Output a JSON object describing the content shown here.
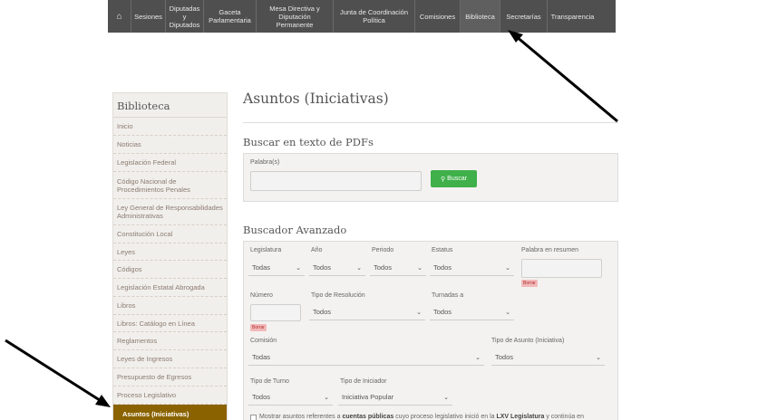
{
  "nav": {
    "items": [
      {
        "label": "Sesiones"
      },
      {
        "label": "Diputadas y Diputados"
      },
      {
        "label": "Gaceta Parlamentaria"
      },
      {
        "label": "Mesa Directiva y Diputación Permanente"
      },
      {
        "label": "Junta de Coordinación Política"
      },
      {
        "label": "Comisiones"
      },
      {
        "label": "Biblioteca"
      },
      {
        "label": "Secretarías"
      },
      {
        "label": "Transparencia"
      }
    ]
  },
  "sidebar": {
    "title": "Biblioteca",
    "items": [
      {
        "label": "Inicio"
      },
      {
        "label": "Noticias"
      },
      {
        "label": "Legislación Federal"
      },
      {
        "label": "Código Nacional de Procedimientos Penales"
      },
      {
        "label": "Ley General de Responsabilidades Administrativas"
      },
      {
        "label": "Constitución Local"
      },
      {
        "label": "Leyes"
      },
      {
        "label": "Códigos"
      },
      {
        "label": "Legislación Estatal Abrogada"
      },
      {
        "label": "Libros"
      },
      {
        "label": "Libros: Catálogo en Línea"
      },
      {
        "label": "Reglamentos"
      },
      {
        "label": "Leyes de Ingresos"
      },
      {
        "label": "Presupuesto de Egresos"
      },
      {
        "label": "Proceso Legislativo"
      },
      {
        "label": "Asuntos (Iniciativas)"
      }
    ]
  },
  "main": {
    "title": "Asuntos (Iniciativas)",
    "pdf_search": {
      "title": "Buscar en texto de PDFs",
      "label": "Palabra(s)",
      "button": "Buscar",
      "value": ""
    },
    "advanced": {
      "title": "Buscador Avanzado",
      "legislatura": {
        "label": "Legislatura",
        "value": "Todas"
      },
      "anio": {
        "label": "Año",
        "value": "Todos"
      },
      "periodo": {
        "label": "Periodo",
        "value": "Todos"
      },
      "estatus": {
        "label": "Estatus",
        "value": "Todos"
      },
      "palabra_resumen": {
        "label": "Palabra en resumen",
        "value": ""
      },
      "numero": {
        "label": "Número",
        "value": ""
      },
      "tipo_resolucion": {
        "label": "Tipo de Resolución",
        "value": "Todos"
      },
      "turnadas": {
        "label": "Turnadas a",
        "value": "Todos"
      },
      "comision": {
        "label": "Comisión",
        "value": "Todas"
      },
      "tipo_asunto": {
        "label": "Tipo de Asunto (Iniciativa)",
        "value": "Todos"
      },
      "tipo_turno": {
        "label": "Tipo de Turno",
        "value": "Todos"
      },
      "tipo_iniciador": {
        "label": "Tipo de Iniciador",
        "value": "Iniciativa Popular"
      },
      "borrar": "Borrar",
      "note_prefix": "Mostrar asuntos referentes a ",
      "note_bold1": "cuentas públicas",
      "note_mid": " cuyo proceso legislativo inició en la ",
      "note_bold2": "LXV Legislatura",
      "note_suffix": " y continúa en"
    }
  },
  "icons": {
    "home": "home-icon",
    "chevron": "chevron-down-icon"
  },
  "colors": {
    "nav_bg": "#4f4f4f",
    "active_sidebar": "#8a6300",
    "search_button": "#3fb04a"
  }
}
